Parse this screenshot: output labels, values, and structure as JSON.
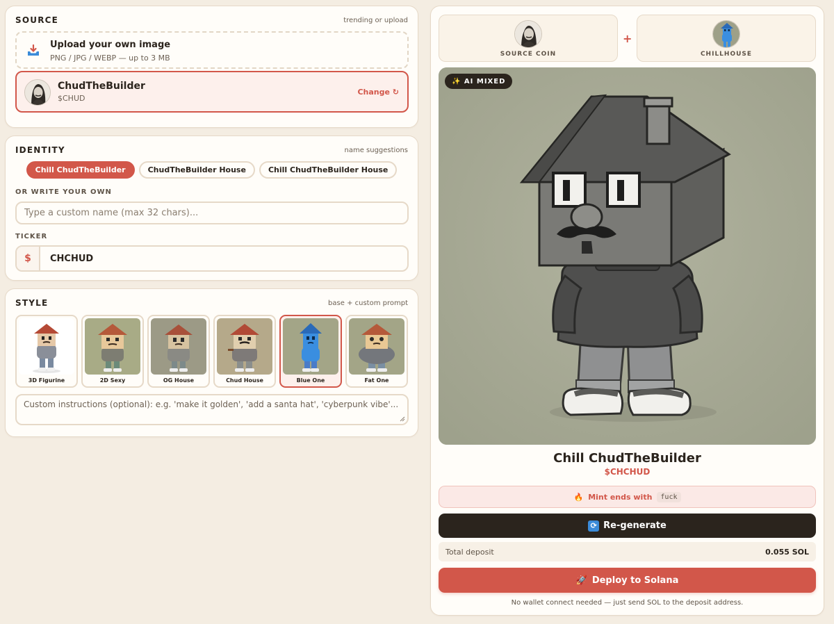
{
  "source": {
    "title": "SOURCE",
    "hint": "trending or upload",
    "upload": {
      "title": "Upload your own image",
      "subtitle": "PNG / JPG / WEBP — up to 3 MB"
    },
    "coin": {
      "name": "ChudTheBuilder",
      "ticker": "$CHUD",
      "change_label": "Change ↻"
    }
  },
  "identity": {
    "title": "IDENTITY",
    "hint": "name suggestions",
    "suggestions": [
      "Chill ChudTheBuilder",
      "ChudTheBuilder House",
      "Chill ChudTheBuilder House"
    ],
    "selected_suggestion": "Chill ChudTheBuilder",
    "custom_label": "OR WRITE YOUR OWN",
    "custom_placeholder": "Type a custom name (max 32 chars)...",
    "custom_value": "",
    "ticker_label": "TICKER",
    "ticker_prefix": "$",
    "ticker_value": "CHCHUD"
  },
  "style": {
    "title": "STYLE",
    "hint": "base + custom prompt",
    "options": [
      "3D Figurine",
      "2D Sexy",
      "OG House",
      "Chud House",
      "Blue One",
      "Fat One"
    ],
    "selected": "Blue One",
    "custom_placeholder": "Custom instructions (optional): e.g. 'make it golden', 'add a santa hat', 'cyberpunk vibe'..."
  },
  "preview": {
    "source_label": "SOURCE COIN",
    "plus": "+",
    "target_label": "CHILLHOUSE",
    "badge": "✨ AI MIXED",
    "name": "Chill ChudTheBuilder",
    "ticker": "$CHCHUD",
    "mint_text": "Mint ends with",
    "mint_emoji": "🔥",
    "mint_code": "fuck",
    "regenerate_label": "Re-generate",
    "deposit_label": "Total deposit",
    "deposit_value": "0.055 SOL",
    "deploy_label": "Deploy to Solana",
    "deploy_emoji": "🚀",
    "note": "No wallet connect needed — just send SOL to the deposit address."
  },
  "colors": {
    "background": "#f4ede2",
    "accent": "#d2574a",
    "dark": "#2b241d",
    "card": "#fffdf9",
    "border": "#e6d9c8"
  }
}
